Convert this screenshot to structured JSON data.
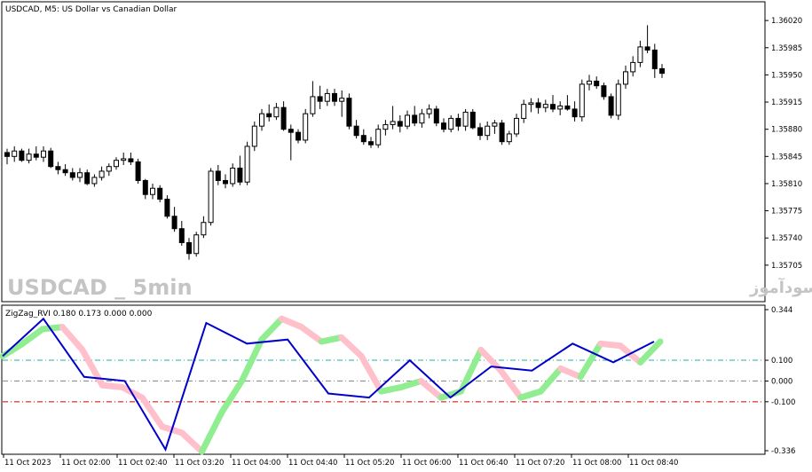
{
  "main_chart": {
    "title": "USDCAD, M5:  US Dollar vs Canadian Dollar",
    "price_ticks": [
      "1.36020",
      "1.35985",
      "1.35950",
      "1.35915",
      "1.35880",
      "1.35845",
      "1.35810",
      "1.35775",
      "1.35740",
      "1.35705"
    ],
    "watermark_symbol": "USDCAD _ 5min",
    "watermark_site": "انتشار در سایت سودآموز"
  },
  "indicator": {
    "title": "ZigZag_RVI 0.180 0.173 0.000 0.000",
    "ticks": [
      "0.344",
      "0.100",
      "0.000",
      "-0.100",
      "-0.336"
    ]
  },
  "time_axis": {
    "labels": [
      "11 Oct 2023",
      "11 Oct 02:00",
      "11 Oct 02:40",
      "11 Oct 03:20",
      "11 Oct 04:00",
      "11 Oct 04:40",
      "11 Oct 05:20",
      "11 Oct 06:00",
      "11 Oct 06:40",
      "11 Oct 07:20",
      "11 Oct 08:00",
      "11 Oct 08:40"
    ]
  },
  "colors": {
    "background": "#ffffff",
    "candle": "#000000",
    "zigzag_line": "#0000cc",
    "rvi_up": "#90ee90",
    "rvi_down": "#ffc0cb",
    "level_100": "#20b2aa",
    "level_0": "#808080",
    "level_m100": "#cc0000"
  },
  "chart_data": [
    {
      "type": "candlestick",
      "title": "USDCAD, M5:  US Dollar vs Canadian Dollar",
      "y_ticks": [
        1.3602,
        1.35985,
        1.3595,
        1.35915,
        1.3588,
        1.35845,
        1.3581,
        1.35775,
        1.3574,
        1.35705
      ],
      "ylim": [
        1.3569,
        1.36035
      ],
      "x_tick_labels": [
        "11 Oct 2023",
        "11 Oct 02:00",
        "11 Oct 02:40",
        "11 Oct 03:20",
        "11 Oct 04:00",
        "11 Oct 04:40",
        "11 Oct 05:20",
        "11 Oct 06:00",
        "11 Oct 06:40",
        "11 Oct 07:20",
        "11 Oct 08:00",
        "11 Oct 08:40"
      ],
      "candles": [
        {
          "o": 1.3585,
          "h": 1.35855,
          "l": 1.35835,
          "c": 1.35845
        },
        {
          "o": 1.35845,
          "h": 1.35858,
          "l": 1.35838,
          "c": 1.35852
        },
        {
          "o": 1.35852,
          "h": 1.35855,
          "l": 1.35838,
          "c": 1.3584
        },
        {
          "o": 1.3584,
          "h": 1.35855,
          "l": 1.35836,
          "c": 1.35848
        },
        {
          "o": 1.35848,
          "h": 1.35858,
          "l": 1.3584,
          "c": 1.35844
        },
        {
          "o": 1.35844,
          "h": 1.35858,
          "l": 1.35838,
          "c": 1.35852
        },
        {
          "o": 1.35852,
          "h": 1.35856,
          "l": 1.3583,
          "c": 1.35832
        },
        {
          "o": 1.35832,
          "h": 1.35838,
          "l": 1.35822,
          "c": 1.35828
        },
        {
          "o": 1.35828,
          "h": 1.35835,
          "l": 1.3582,
          "c": 1.35824
        },
        {
          "o": 1.35824,
          "h": 1.3583,
          "l": 1.35814,
          "c": 1.35818
        },
        {
          "o": 1.35818,
          "h": 1.3583,
          "l": 1.35812,
          "c": 1.35824
        },
        {
          "o": 1.35824,
          "h": 1.35828,
          "l": 1.35808,
          "c": 1.3581
        },
        {
          "o": 1.3581,
          "h": 1.35822,
          "l": 1.35806,
          "c": 1.35818
        },
        {
          "o": 1.35818,
          "h": 1.35832,
          "l": 1.35814,
          "c": 1.35826
        },
        {
          "o": 1.35826,
          "h": 1.35836,
          "l": 1.3582,
          "c": 1.35832
        },
        {
          "o": 1.35832,
          "h": 1.35844,
          "l": 1.35828,
          "c": 1.3584
        },
        {
          "o": 1.3584,
          "h": 1.3585,
          "l": 1.35834,
          "c": 1.35842
        },
        {
          "o": 1.35842,
          "h": 1.3585,
          "l": 1.35834,
          "c": 1.35838
        },
        {
          "o": 1.35838,
          "h": 1.35842,
          "l": 1.3581,
          "c": 1.35814
        },
        {
          "o": 1.35814,
          "h": 1.35816,
          "l": 1.3579,
          "c": 1.35796
        },
        {
          "o": 1.35796,
          "h": 1.3581,
          "l": 1.3579,
          "c": 1.35804
        },
        {
          "o": 1.35804,
          "h": 1.35808,
          "l": 1.35786,
          "c": 1.3579
        },
        {
          "o": 1.3579,
          "h": 1.35795,
          "l": 1.35765,
          "c": 1.35768
        },
        {
          "o": 1.35768,
          "h": 1.3578,
          "l": 1.35748,
          "c": 1.35752
        },
        {
          "o": 1.35752,
          "h": 1.35762,
          "l": 1.3573,
          "c": 1.35734
        },
        {
          "o": 1.35734,
          "h": 1.3574,
          "l": 1.35712,
          "c": 1.3572
        },
        {
          "o": 1.3572,
          "h": 1.35748,
          "l": 1.35716,
          "c": 1.35744
        },
        {
          "o": 1.35744,
          "h": 1.35768,
          "l": 1.3574,
          "c": 1.3576
        },
        {
          "o": 1.3576,
          "h": 1.3583,
          "l": 1.35756,
          "c": 1.35826
        },
        {
          "o": 1.35826,
          "h": 1.35834,
          "l": 1.35808,
          "c": 1.35814
        },
        {
          "o": 1.35814,
          "h": 1.35822,
          "l": 1.35804,
          "c": 1.3581
        },
        {
          "o": 1.3581,
          "h": 1.35836,
          "l": 1.35806,
          "c": 1.3583
        },
        {
          "o": 1.3583,
          "h": 1.35846,
          "l": 1.35808,
          "c": 1.35812
        },
        {
          "o": 1.35812,
          "h": 1.35864,
          "l": 1.35808,
          "c": 1.35858
        },
        {
          "o": 1.35858,
          "h": 1.3589,
          "l": 1.35852,
          "c": 1.35884
        },
        {
          "o": 1.35884,
          "h": 1.35906,
          "l": 1.35878,
          "c": 1.359
        },
        {
          "o": 1.359,
          "h": 1.35912,
          "l": 1.3589,
          "c": 1.35896
        },
        {
          "o": 1.35896,
          "h": 1.35914,
          "l": 1.35892,
          "c": 1.35908
        },
        {
          "o": 1.35908,
          "h": 1.35916,
          "l": 1.35878,
          "c": 1.3588
        },
        {
          "o": 1.3588,
          "h": 1.35886,
          "l": 1.3584,
          "c": 1.35876
        },
        {
          "o": 1.35876,
          "h": 1.3588,
          "l": 1.35862,
          "c": 1.35866
        },
        {
          "o": 1.35866,
          "h": 1.35906,
          "l": 1.35862,
          "c": 1.359
        },
        {
          "o": 1.359,
          "h": 1.35942,
          "l": 1.35896,
          "c": 1.35922
        },
        {
          "o": 1.35922,
          "h": 1.35936,
          "l": 1.35906,
          "c": 1.35916
        },
        {
          "o": 1.35916,
          "h": 1.35932,
          "l": 1.3591,
          "c": 1.35926
        },
        {
          "o": 1.35926,
          "h": 1.35932,
          "l": 1.3591,
          "c": 1.35916
        },
        {
          "o": 1.35916,
          "h": 1.3593,
          "l": 1.35896,
          "c": 1.3592
        },
        {
          "o": 1.3592,
          "h": 1.35926,
          "l": 1.3588,
          "c": 1.35884
        },
        {
          "o": 1.35884,
          "h": 1.35892,
          "l": 1.35868,
          "c": 1.35872
        },
        {
          "o": 1.35872,
          "h": 1.3588,
          "l": 1.3586,
          "c": 1.35864
        },
        {
          "o": 1.35864,
          "h": 1.3587,
          "l": 1.35856,
          "c": 1.3586
        },
        {
          "o": 1.3586,
          "h": 1.35886,
          "l": 1.35856,
          "c": 1.3588
        },
        {
          "o": 1.3588,
          "h": 1.35892,
          "l": 1.35872,
          "c": 1.35886
        },
        {
          "o": 1.35886,
          "h": 1.3591,
          "l": 1.3588,
          "c": 1.3589
        },
        {
          "o": 1.3589,
          "h": 1.35898,
          "l": 1.35876,
          "c": 1.35884
        },
        {
          "o": 1.35884,
          "h": 1.35904,
          "l": 1.3588,
          "c": 1.35898
        },
        {
          "o": 1.35898,
          "h": 1.3591,
          "l": 1.35884,
          "c": 1.35888
        },
        {
          "o": 1.35888,
          "h": 1.35906,
          "l": 1.35882,
          "c": 1.359
        },
        {
          "o": 1.359,
          "h": 1.35912,
          "l": 1.35894,
          "c": 1.35906
        },
        {
          "o": 1.35906,
          "h": 1.3591,
          "l": 1.35884,
          "c": 1.35888
        },
        {
          "o": 1.35888,
          "h": 1.35894,
          "l": 1.35876,
          "c": 1.3588
        },
        {
          "o": 1.3588,
          "h": 1.35898,
          "l": 1.35876,
          "c": 1.35894
        },
        {
          "o": 1.35894,
          "h": 1.359,
          "l": 1.35878,
          "c": 1.35884
        },
        {
          "o": 1.35884,
          "h": 1.35906,
          "l": 1.35878,
          "c": 1.35902
        },
        {
          "o": 1.35902,
          "h": 1.35906,
          "l": 1.3588,
          "c": 1.35882
        },
        {
          "o": 1.35882,
          "h": 1.35888,
          "l": 1.35866,
          "c": 1.35872
        },
        {
          "o": 1.35872,
          "h": 1.3589,
          "l": 1.35866,
          "c": 1.35884
        },
        {
          "o": 1.35884,
          "h": 1.35892,
          "l": 1.35874,
          "c": 1.35888
        },
        {
          "o": 1.35888,
          "h": 1.35892,
          "l": 1.3586,
          "c": 1.35864
        },
        {
          "o": 1.35864,
          "h": 1.35878,
          "l": 1.3586,
          "c": 1.35874
        },
        {
          "o": 1.35874,
          "h": 1.359,
          "l": 1.3587,
          "c": 1.35894
        },
        {
          "o": 1.35894,
          "h": 1.35918,
          "l": 1.35888,
          "c": 1.35912
        },
        {
          "o": 1.35912,
          "h": 1.3592,
          "l": 1.35902,
          "c": 1.35914
        },
        {
          "o": 1.35914,
          "h": 1.3592,
          "l": 1.359,
          "c": 1.35908
        },
        {
          "o": 1.35908,
          "h": 1.35918,
          "l": 1.35902,
          "c": 1.35912
        },
        {
          "o": 1.35912,
          "h": 1.35924,
          "l": 1.35902,
          "c": 1.35906
        },
        {
          "o": 1.35906,
          "h": 1.35916,
          "l": 1.35898,
          "c": 1.3591
        },
        {
          "o": 1.3591,
          "h": 1.35924,
          "l": 1.35904,
          "c": 1.35906
        },
        {
          "o": 1.35906,
          "h": 1.35916,
          "l": 1.3589,
          "c": 1.35896
        },
        {
          "o": 1.35896,
          "h": 1.35944,
          "l": 1.3589,
          "c": 1.35938
        },
        {
          "o": 1.35938,
          "h": 1.3595,
          "l": 1.3593,
          "c": 1.35942
        },
        {
          "o": 1.35942,
          "h": 1.35948,
          "l": 1.35932,
          "c": 1.35936
        },
        {
          "o": 1.35936,
          "h": 1.3594,
          "l": 1.35918,
          "c": 1.35922
        },
        {
          "o": 1.35922,
          "h": 1.35926,
          "l": 1.35894,
          "c": 1.35898
        },
        {
          "o": 1.35898,
          "h": 1.35944,
          "l": 1.35892,
          "c": 1.35938
        },
        {
          "o": 1.35938,
          "h": 1.35962,
          "l": 1.35932,
          "c": 1.35954
        },
        {
          "o": 1.35954,
          "h": 1.35974,
          "l": 1.35948,
          "c": 1.35966
        },
        {
          "o": 1.35966,
          "h": 1.35994,
          "l": 1.3596,
          "c": 1.35986
        },
        {
          "o": 1.35986,
          "h": 1.36014,
          "l": 1.35978,
          "c": 1.35982
        },
        {
          "o": 1.35982,
          "h": 1.3599,
          "l": 1.35946,
          "c": 1.35958
        },
        {
          "o": 1.35958,
          "h": 1.35964,
          "l": 1.35946,
          "c": 1.35952
        }
      ]
    },
    {
      "type": "line",
      "title": "ZigZag_RVI 0.180 0.173 0.000 0.000",
      "y_ticks": [
        0.344,
        0.1,
        0.0,
        -0.1,
        -0.336
      ],
      "ylim": [
        -0.336,
        0.344
      ],
      "levels": [
        0.1,
        0.0,
        -0.1
      ],
      "series": [
        {
          "values": [
            0.12,
            0.18,
            0.25,
            0.26,
            0.15,
            -0.02,
            -0.03,
            -0.08,
            -0.22,
            -0.25,
            -0.34,
            -0.15,
            0.0,
            0.2,
            0.3,
            0.26,
            0.19,
            0.21,
            0.12,
            -0.05,
            -0.03,
            0.0,
            -0.08,
            -0.05,
            0.15,
            0.05,
            -0.08,
            -0.05,
            0.06,
            0.02,
            0.18,
            0.17,
            0.09,
            0.19
          ]
        },
        {
          "values": [
            0.12,
            0.3,
            0.02,
            0.0,
            -0.33,
            0.28,
            0.18,
            0.2,
            -0.06,
            -0.08,
            0.1,
            -0.08,
            0.07,
            0.05,
            0.18,
            0.09,
            0.19
          ]
        }
      ]
    }
  ]
}
